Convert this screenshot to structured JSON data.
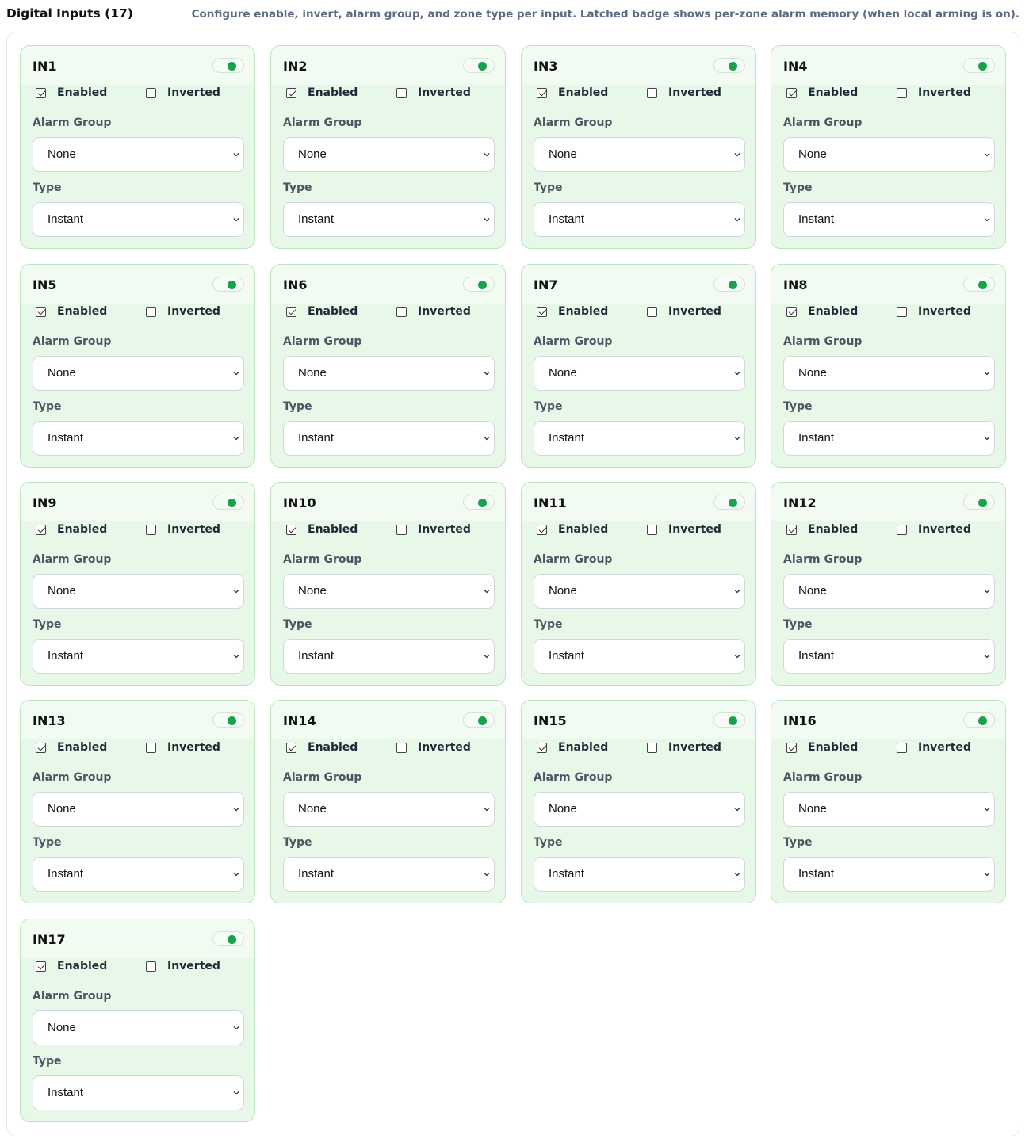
{
  "header": {
    "title": "Digital Inputs (17)",
    "description": "Configure enable, invert, alarm group, and zone type per input. Latched badge shows per-zone alarm memory (when local arming is on)."
  },
  "labels": {
    "enabled": "Enabled",
    "inverted": "Inverted",
    "alarm_group": "Alarm Group",
    "type": "Type"
  },
  "colors": {
    "card_bg": "#e8f8e8",
    "card_border": "#bfe3c1",
    "status_on": "#16a34a"
  },
  "inputs": [
    {
      "name": "IN1",
      "enabled": true,
      "inverted": false,
      "alarm_group": "None",
      "type": "Instant",
      "status": "on"
    },
    {
      "name": "IN2",
      "enabled": true,
      "inverted": false,
      "alarm_group": "None",
      "type": "Instant",
      "status": "on"
    },
    {
      "name": "IN3",
      "enabled": true,
      "inverted": false,
      "alarm_group": "None",
      "type": "Instant",
      "status": "on"
    },
    {
      "name": "IN4",
      "enabled": true,
      "inverted": false,
      "alarm_group": "None",
      "type": "Instant",
      "status": "on"
    },
    {
      "name": "IN5",
      "enabled": true,
      "inverted": false,
      "alarm_group": "None",
      "type": "Instant",
      "status": "on"
    },
    {
      "name": "IN6",
      "enabled": true,
      "inverted": false,
      "alarm_group": "None",
      "type": "Instant",
      "status": "on"
    },
    {
      "name": "IN7",
      "enabled": true,
      "inverted": false,
      "alarm_group": "None",
      "type": "Instant",
      "status": "on"
    },
    {
      "name": "IN8",
      "enabled": true,
      "inverted": false,
      "alarm_group": "None",
      "type": "Instant",
      "status": "on"
    },
    {
      "name": "IN9",
      "enabled": true,
      "inverted": false,
      "alarm_group": "None",
      "type": "Instant",
      "status": "on"
    },
    {
      "name": "IN10",
      "enabled": true,
      "inverted": false,
      "alarm_group": "None",
      "type": "Instant",
      "status": "on"
    },
    {
      "name": "IN11",
      "enabled": true,
      "inverted": false,
      "alarm_group": "None",
      "type": "Instant",
      "status": "on"
    },
    {
      "name": "IN12",
      "enabled": true,
      "inverted": false,
      "alarm_group": "None",
      "type": "Instant",
      "status": "on"
    },
    {
      "name": "IN13",
      "enabled": true,
      "inverted": false,
      "alarm_group": "None",
      "type": "Instant",
      "status": "on"
    },
    {
      "name": "IN14",
      "enabled": true,
      "inverted": false,
      "alarm_group": "None",
      "type": "Instant",
      "status": "on"
    },
    {
      "name": "IN15",
      "enabled": true,
      "inverted": false,
      "alarm_group": "None",
      "type": "Instant",
      "status": "on"
    },
    {
      "name": "IN16",
      "enabled": true,
      "inverted": false,
      "alarm_group": "None",
      "type": "Instant",
      "status": "on"
    },
    {
      "name": "IN17",
      "enabled": true,
      "inverted": false,
      "alarm_group": "None",
      "type": "Instant",
      "status": "on"
    }
  ]
}
